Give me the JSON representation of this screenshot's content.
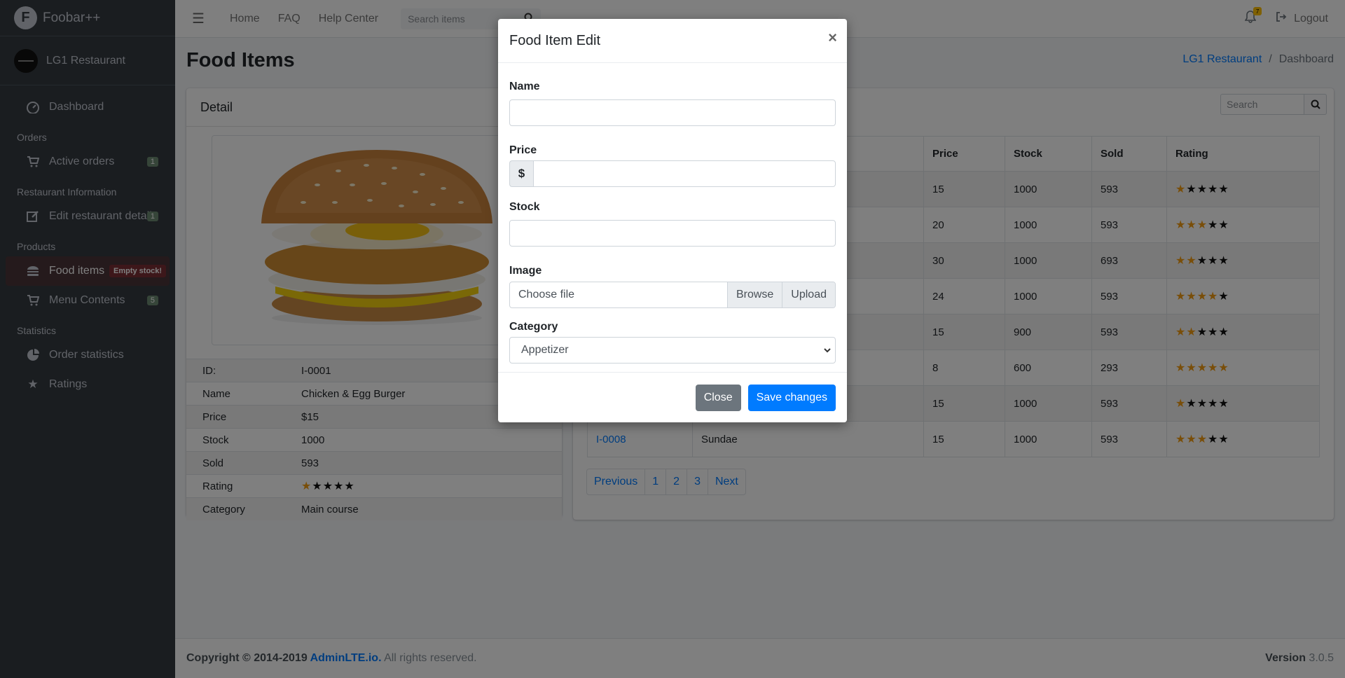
{
  "brand": {
    "name": "Foobar++",
    "logo_letter": "F"
  },
  "user": {
    "name": "LG1 Restaurant"
  },
  "sidebar": {
    "dashboard": {
      "label": "Dashboard",
      "icon": "dashboard-gauge-icon"
    },
    "orders_header": "Orders",
    "active_orders": {
      "label": "Active orders",
      "badge": "1",
      "icon": "cart-icon"
    },
    "restaurant_header": "Restaurant Information",
    "edit_details": {
      "label": "Edit restaurant details",
      "badge": "1",
      "icon": "edit-icon"
    },
    "products_header": "Products",
    "food_items": {
      "label": "Food items",
      "badge": "Empty stock!",
      "icon": "hamburger-icon"
    },
    "menu_contents": {
      "label": "Menu Contents",
      "badge": "5",
      "icon": "cart-icon"
    },
    "statistics_header": "Statistics",
    "order_statistics": {
      "label": "Order statistics",
      "icon": "pie-chart-icon"
    },
    "ratings": {
      "label": "Ratings",
      "icon": "star-icon"
    }
  },
  "topnav": {
    "home": "Home",
    "faq": "FAQ",
    "help": "Help Center",
    "search_placeholder": "Search items",
    "notification_count": "7",
    "logout": "Logout"
  },
  "page": {
    "title": "Food Items",
    "breadcrumb": [
      "LG1 Restaurant",
      "Dashboard"
    ]
  },
  "detail": {
    "header": "Detail",
    "rows": [
      {
        "label": "ID:",
        "value": "I-0001"
      },
      {
        "label": "Name",
        "value": "Chicken & Egg Burger"
      },
      {
        "label": "Price",
        "value": "$15"
      },
      {
        "label": "Stock",
        "value": "1000"
      },
      {
        "label": "Sold",
        "value": "593"
      },
      {
        "label": "Rating",
        "value": ""
      },
      {
        "label": "Category",
        "value": "Main course"
      }
    ],
    "rating_stars": 1
  },
  "list": {
    "search_placeholder": "Search",
    "columns": [
      "Price",
      "Stock",
      "Sold",
      "Rating"
    ],
    "rows": [
      {
        "id": "",
        "name": "",
        "price": "15",
        "stock": "1000",
        "sold": "593",
        "rating": 1
      },
      {
        "id": "",
        "name": "",
        "price": "20",
        "stock": "1000",
        "sold": "593",
        "rating": 3
      },
      {
        "id": "",
        "name": "",
        "price": "30",
        "stock": "1000",
        "sold": "693",
        "rating": 2
      },
      {
        "id": "",
        "name": "",
        "price": "24",
        "stock": "1000",
        "sold": "593",
        "rating": 4
      },
      {
        "id": "",
        "name": "",
        "price": "15",
        "stock": "900",
        "sold": "593",
        "rating": 2
      },
      {
        "id": "",
        "name": "",
        "price": "8",
        "stock": "600",
        "sold": "293",
        "rating": 5
      },
      {
        "id": "",
        "name": "",
        "price": "15",
        "stock": "1000",
        "sold": "593",
        "rating": 1
      },
      {
        "id": "I-0008",
        "name": "Sundae",
        "price": "15",
        "stock": "1000",
        "sold": "593",
        "rating": 3
      }
    ],
    "pager": [
      "Previous",
      "1",
      "2",
      "3",
      "Next"
    ]
  },
  "footer": {
    "copyright": "Copyright © 2014-2019 ",
    "link": "AdminLTE.io.",
    "rights": " All rights reserved.",
    "version_label": "Version",
    "version": " 3.0.5"
  },
  "modal": {
    "title": "Food Item Edit",
    "close_symbol": "×",
    "name_label": "Name",
    "name_value": "",
    "price_label": "Price",
    "price_prefix": "$",
    "price_value": "",
    "stock_label": "Stock",
    "stock_value": "",
    "image_label": "Image",
    "file_placeholder": "Choose file",
    "browse": "Browse",
    "upload": "Upload",
    "category_label": "Category",
    "category_selected": "Appetizer",
    "close_button": "Close",
    "save_button": "Save changes"
  }
}
